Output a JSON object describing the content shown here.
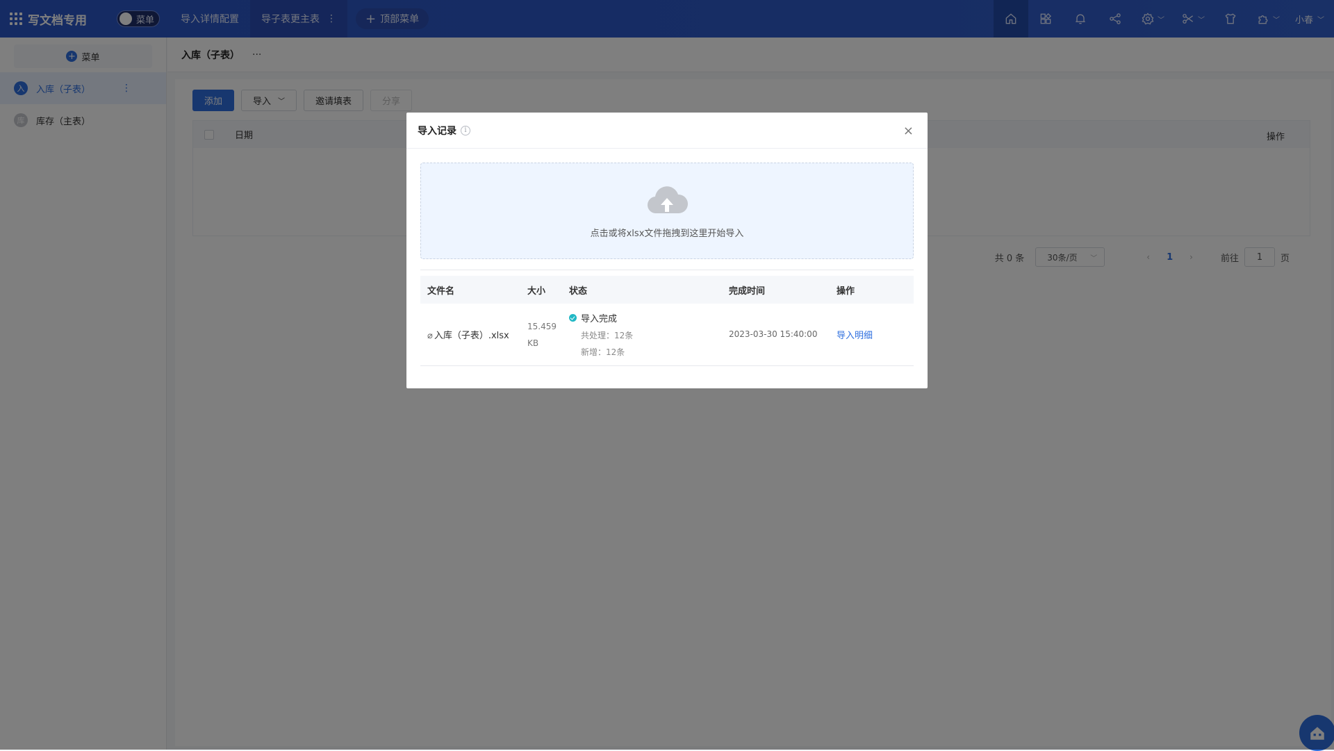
{
  "header": {
    "app_title": "写文档专用",
    "menu_toggle_label": "菜单",
    "tabs": [
      {
        "label": "导入详情配置"
      },
      {
        "label": "导子表更主表"
      }
    ],
    "add_top_menu_label": "顶部菜单",
    "user_name": "小春"
  },
  "sidebar": {
    "add_label": "菜单",
    "items": [
      {
        "label": "入库（子表）",
        "badge": "入"
      },
      {
        "label": "库存（主表）",
        "badge": "库"
      }
    ]
  },
  "page": {
    "title": "入库（子表）",
    "more": "···"
  },
  "toolbar": {
    "add_label": "添加",
    "import_label": "导入",
    "invite_label": "邀请填表",
    "share_label": "分享"
  },
  "table": {
    "columns": {
      "date": "日期",
      "operation": "操作"
    }
  },
  "pagination": {
    "total": "共 0 条",
    "page_size": "30条/页",
    "prev": "‹",
    "current": "1",
    "next": "›",
    "goto_prefix": "前往",
    "goto_value": "1",
    "goto_suffix": "页"
  },
  "modal": {
    "title": "导入记录",
    "close": "×",
    "upload_hint": "点击或将xlsx文件拖拽到这里开始导入",
    "columns": {
      "filename": "文件名",
      "size": "大小",
      "status": "状态",
      "finished_at": "完成时间",
      "operation": "操作"
    },
    "records": [
      {
        "filename": "入库（子表）.xlsx",
        "size_num": "15.459",
        "size_unit": "KB",
        "status": "导入完成",
        "processed": "共处理：12条",
        "added": "新增：12条",
        "finished_at": "2023-03-30 15:40:00",
        "action": "导入明细"
      }
    ]
  },
  "colors": {
    "header_bg": "#2f5bc9",
    "primary": "#2f6fdf",
    "success": "#22b8c5"
  }
}
